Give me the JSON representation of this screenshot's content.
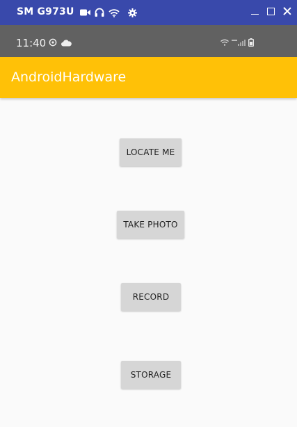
{
  "window": {
    "device_title": "SM G973U",
    "icons": [
      "video-camera-icon",
      "headphones-icon",
      "wifi-icon",
      "settings-gear-icon"
    ],
    "controls": [
      "minimize-icon",
      "maximize-icon",
      "close-icon"
    ]
  },
  "status_bar": {
    "time": "11:40",
    "left_icons": [
      "sync-icon",
      "cloud-icon"
    ],
    "right_icons": [
      "wifi-icon",
      "lte-signal-icon",
      "battery-icon"
    ]
  },
  "app_bar": {
    "title": "AndroidHardware",
    "color": "#ffc107"
  },
  "buttons": [
    {
      "label": "LOCATE ME"
    },
    {
      "label": "TAKE PHOTO"
    },
    {
      "label": "RECORD"
    },
    {
      "label": "STORAGE"
    }
  ],
  "colors": {
    "window_bar": "#3949ab",
    "status_bar": "#616161",
    "background": "#fafafa",
    "button": "#d6d6d6"
  }
}
